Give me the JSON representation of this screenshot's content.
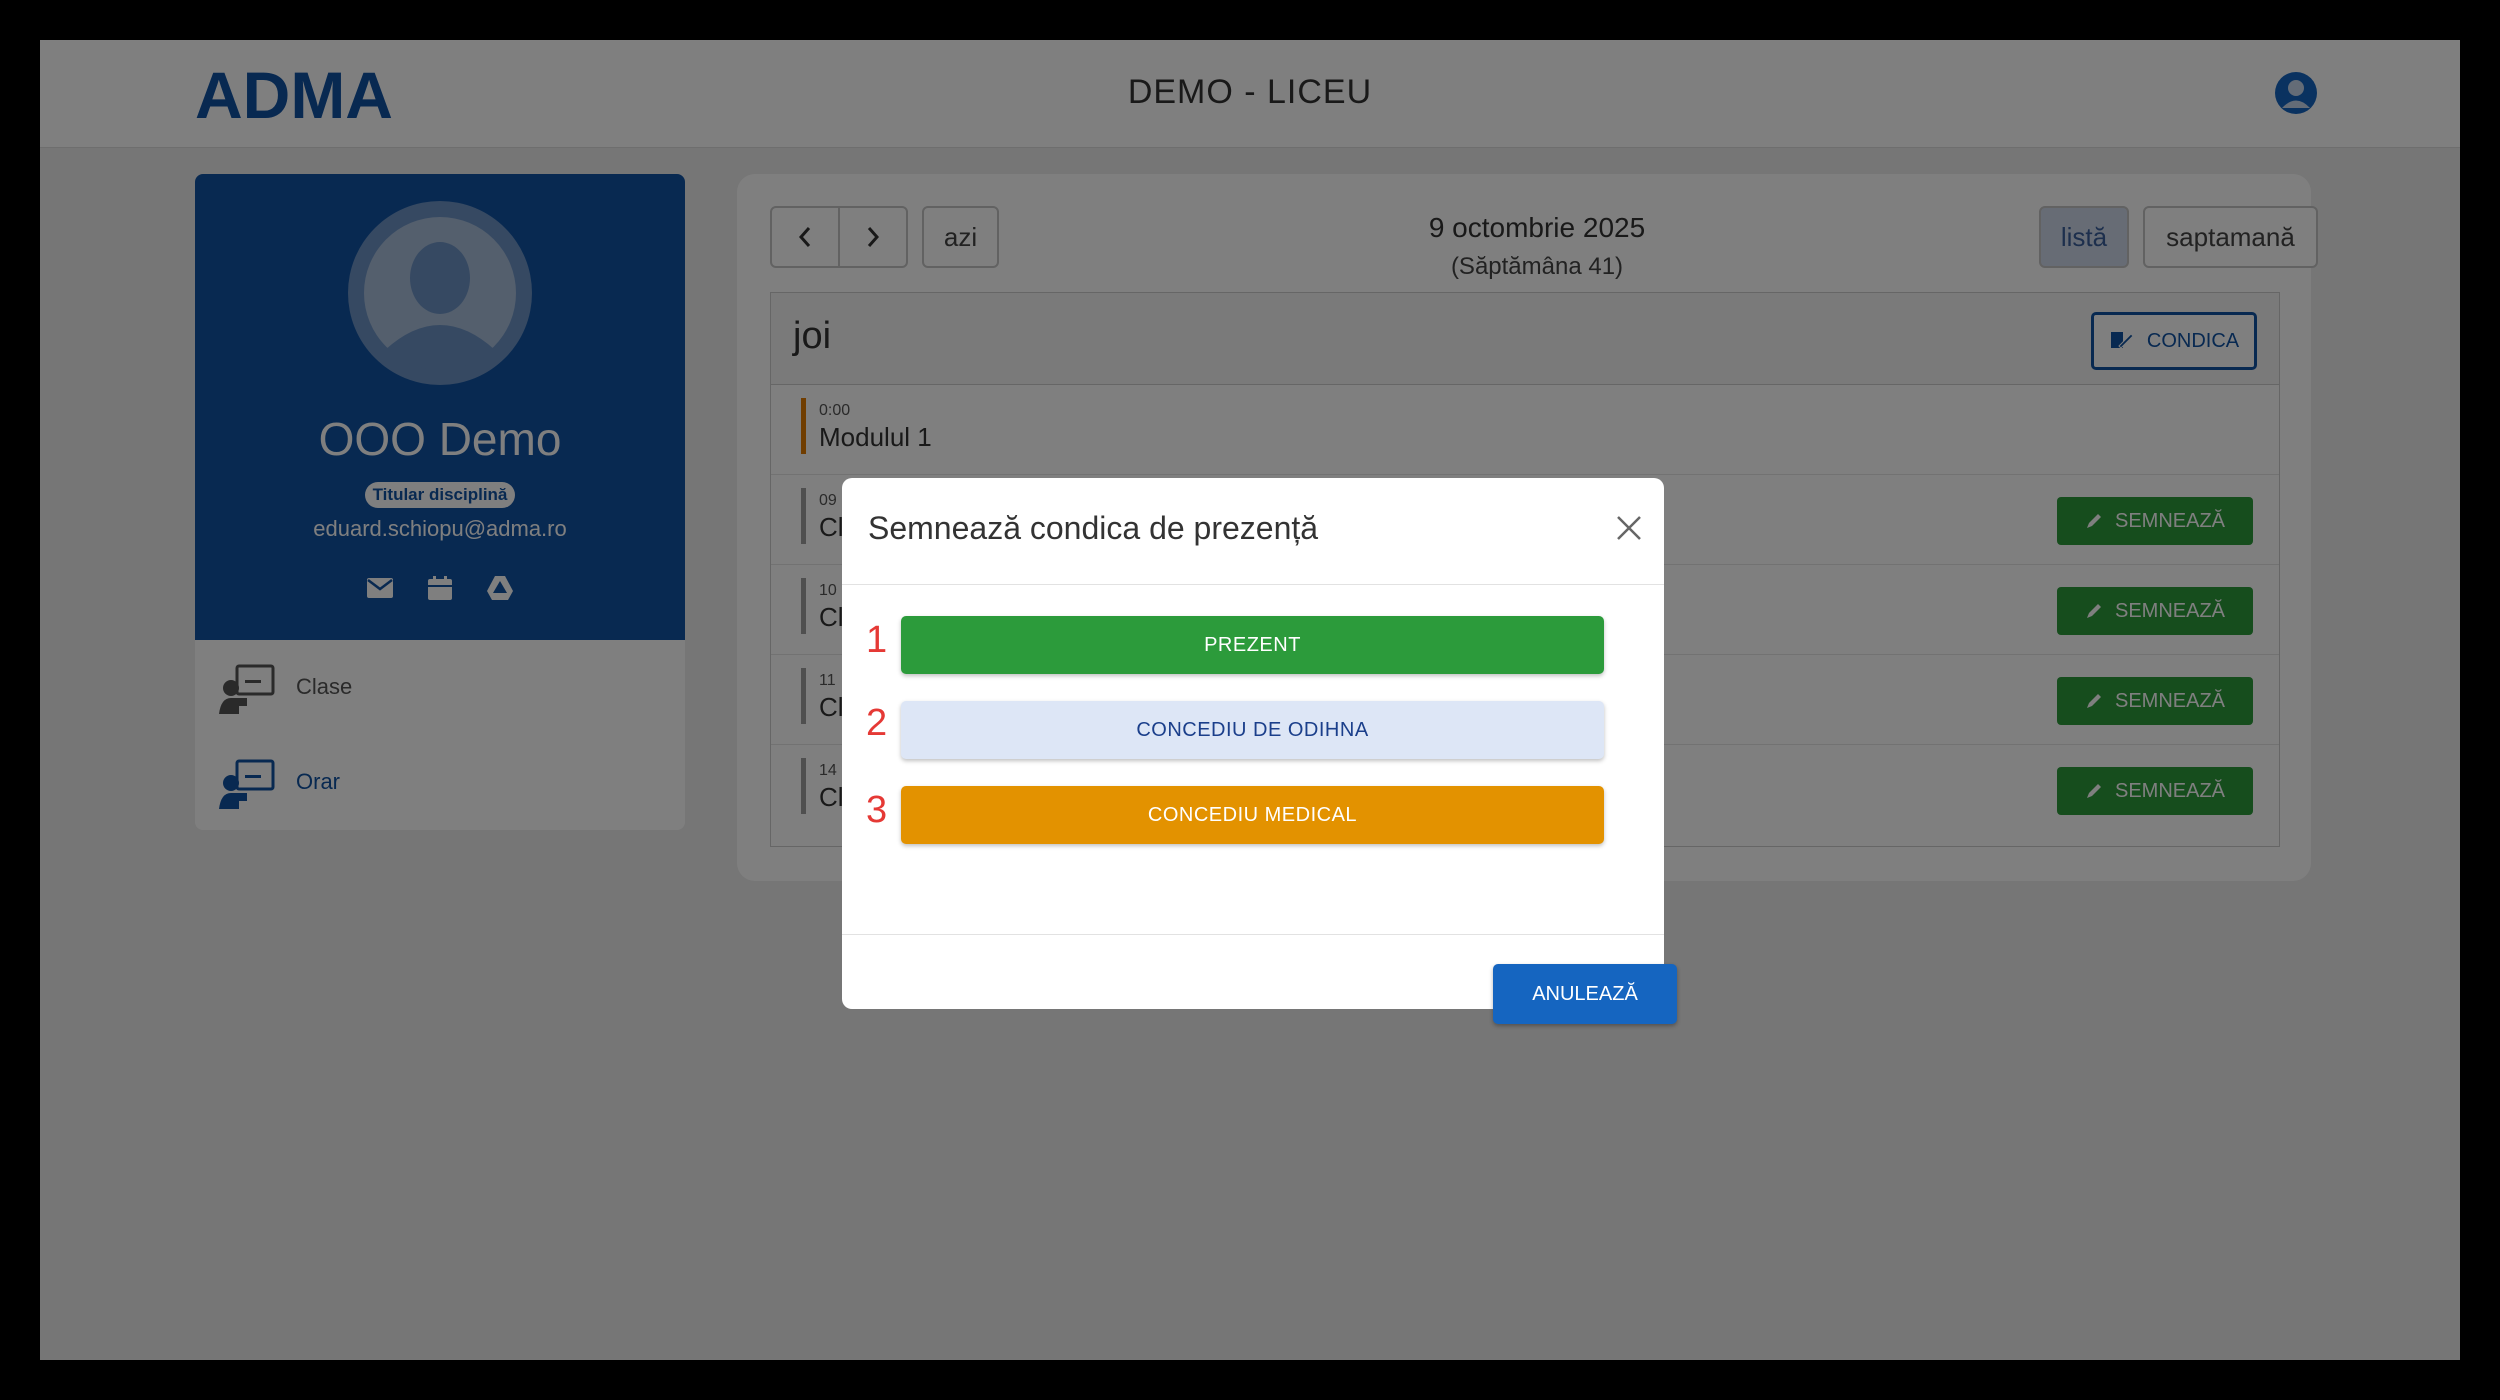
{
  "header": {
    "logo_text": "ADMA",
    "site_title": "DEMO - LICEU"
  },
  "profile": {
    "name": "OOO Demo",
    "role": "Titular disciplină",
    "email": "eduard.schiopu@adma.ro"
  },
  "sidebar": {
    "items": [
      {
        "label": "Clase",
        "active": false
      },
      {
        "label": "Orar",
        "active": true
      }
    ]
  },
  "calendar": {
    "today_label": "azi",
    "date": "9 octombrie 2025",
    "week": "(Săptămâna 41)",
    "view_list": "listă",
    "view_week": "saptamană",
    "day": "joi",
    "condica_label": "CONDICA",
    "events": [
      {
        "time": "0:00",
        "title": "Modulul 1",
        "accent": "#e07b00",
        "has_button": false
      },
      {
        "time": "09",
        "title": "Cl",
        "has_button": true
      },
      {
        "time": "10",
        "title": "Cl",
        "has_button": true
      },
      {
        "time": "11",
        "title": "Cl",
        "has_button": true
      },
      {
        "time": "14",
        "title": "Cl",
        "has_button": true
      }
    ],
    "sign_label": "SEMNEAZĂ"
  },
  "modal": {
    "title": "Semnează condica de prezență",
    "options": [
      {
        "num": "1",
        "label": "PREZENT",
        "bg": "#2c9b3b",
        "fg": "#ffffff"
      },
      {
        "num": "2",
        "label": "CONCEDIU DE ODIHNA",
        "bg": "#dde6f6",
        "fg": "#1b3f8b"
      },
      {
        "num": "3",
        "label": "CONCEDIU MEDICAL",
        "bg": "#e39200",
        "fg": "#ffffff"
      }
    ],
    "cancel_label": "ANULEAZĂ"
  },
  "colors": {
    "primary": "#1052a3",
    "success": "#2c9b3b",
    "warning": "#e39200",
    "danger_number": "#e53935"
  }
}
